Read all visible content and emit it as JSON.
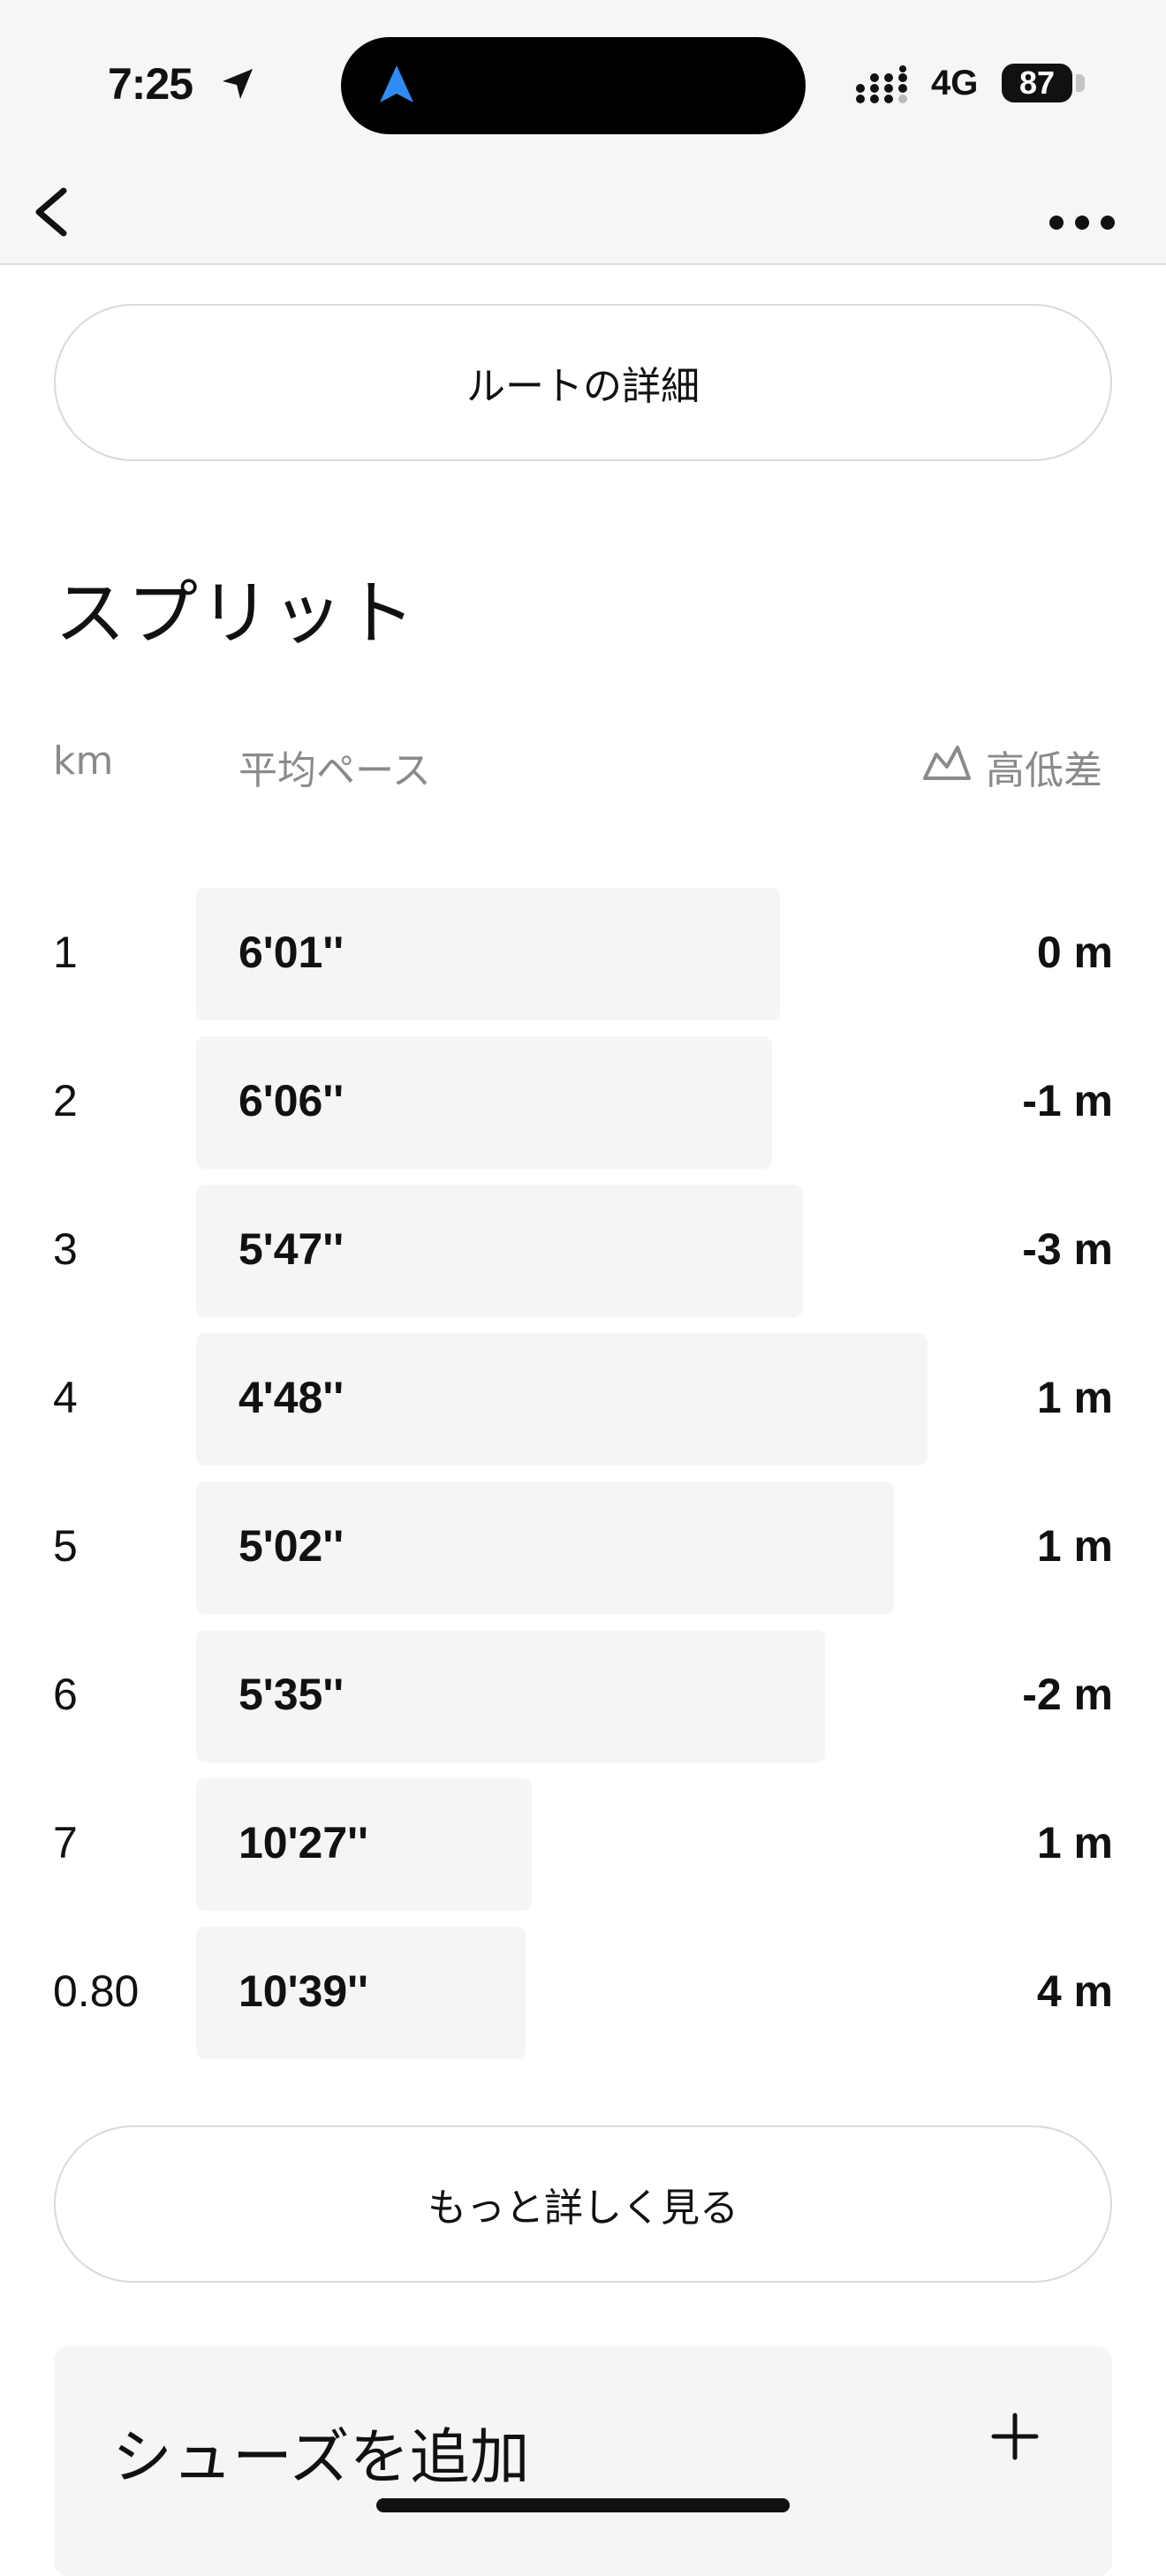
{
  "status_bar": {
    "time": "7:25",
    "network": "4G",
    "battery": "87"
  },
  "nav": {
    "back_icon": "chevron-left-icon",
    "more_icon": "ellipsis-icon"
  },
  "route_button": {
    "label": "ルートの詳細"
  },
  "splits": {
    "title": "スプリット",
    "columns": {
      "km": "km",
      "pace": "平均ペース",
      "elevation": "高低差"
    },
    "rows": [
      {
        "km": "1",
        "pace": "6'01''",
        "elevation": "0 m",
        "pace_seconds": 361
      },
      {
        "km": "2",
        "pace": "6'06''",
        "elevation": "-1 m",
        "pace_seconds": 366
      },
      {
        "km": "3",
        "pace": "5'47''",
        "elevation": "-3 m",
        "pace_seconds": 347
      },
      {
        "km": "4",
        "pace": "4'48''",
        "elevation": "1 m",
        "pace_seconds": 288
      },
      {
        "km": "5",
        "pace": "5'02''",
        "elevation": "1 m",
        "pace_seconds": 302
      },
      {
        "km": "6",
        "pace": "5'35''",
        "elevation": "-2 m",
        "pace_seconds": 335
      },
      {
        "km": "7",
        "pace": "10'27''",
        "elevation": "1 m",
        "pace_seconds": 627
      },
      {
        "km": "0.80",
        "pace": "10'39''",
        "elevation": "4 m",
        "pace_seconds": 639
      }
    ]
  },
  "more_button": {
    "label": "もっと詳しく見る"
  },
  "shoes": {
    "label": "シューズを追加",
    "icon": "plus-icon"
  },
  "colors": {
    "accent": "#2f8cf5",
    "bar": "#f5f5f5",
    "muted": "#8a8a8a"
  }
}
